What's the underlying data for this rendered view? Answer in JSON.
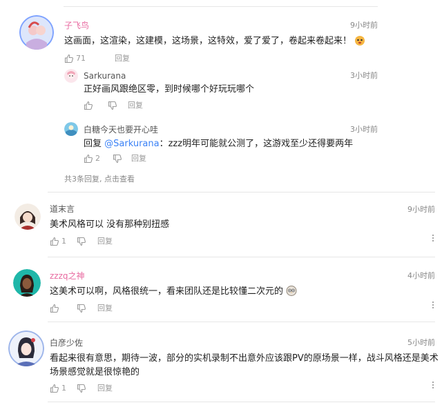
{
  "thread": {
    "top": {
      "name": "子飞鸟",
      "time": "9小时前",
      "text": "这画面，这渲染，这建模，这场景，这特效，爱了爱了，卷起来卷起来！",
      "likes": "71",
      "reply_label": "回复",
      "emoji_icon": "cat-face-icon"
    },
    "replies": [
      {
        "name": "Sarkurana",
        "time": "3小时前",
        "text": "正好画风跟绝区零，到时候哪个好玩玩哪个",
        "likes": "",
        "reply_label": "回复"
      },
      {
        "name": "白糖今天也要开心哇",
        "time": "3小时前",
        "reply_prefix": "回复 ",
        "mention": "@Sarkurana",
        "text": "：zzz明年可能就公测了，这游戏至少还得要两年",
        "likes": "2",
        "reply_label": "回复"
      }
    ],
    "summary": "共3条回复, 点击查看"
  },
  "comments": [
    {
      "name": "道末言",
      "time": "9小时前",
      "text": "美术风格可以 没有那种别扭感",
      "likes": "1",
      "reply_label": "回复"
    },
    {
      "name": "zzzq之神",
      "time": "4小时前",
      "text": "这美术可以啊，风格很统一，看来团队还是比较懂二次元的",
      "likes": "",
      "reply_label": "回复",
      "emoji_icon": "owl-face-icon"
    },
    {
      "name": "白彦少佐",
      "time": "5小时前",
      "text_line1": "看起来很有意思，期待一波，部分的实机录制不出意外应该跟PV的原场景一样，战斗风格还是美术",
      "text_line2": "场景感觉就是很惊艳的",
      "likes": "1",
      "reply_label": "回复"
    }
  ],
  "colors": {
    "pink_name": "#e86aa0",
    "mention": "#3b82f6",
    "gray_text": "#888888"
  }
}
